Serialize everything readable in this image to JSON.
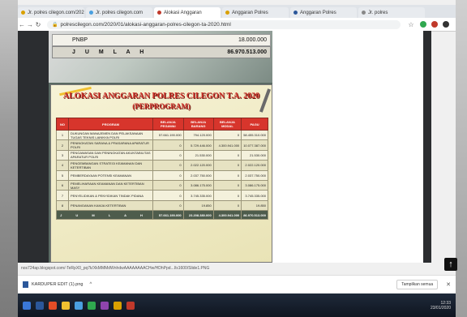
{
  "browser": {
    "tabs": [
      {
        "label": "Jr. polres cilegon.com/2020",
        "active": false,
        "color": "#d9a000"
      },
      {
        "label": "Jr. polres cilegon.com",
        "active": false,
        "color": "#4aa0e0"
      },
      {
        "label": "Alokasi Anggaran",
        "active": true,
        "color": "#c0392b"
      },
      {
        "label": "Anggaran Polres",
        "active": false,
        "color": "#d9a000"
      },
      {
        "label": "Anggaran Polres",
        "active": false,
        "color": "#2b579a"
      },
      {
        "label": "Jr. polres",
        "active": false,
        "color": "#888888"
      }
    ],
    "url": "polrescilegon.com/2020/01/alokasi-anggaran-polres-cilegon-ta-2020.html"
  },
  "document": {
    "top_rows": [
      {
        "label": "PNBP",
        "value": "18.000.000"
      },
      {
        "label": "J U M L A H",
        "value": "86.970.513.000"
      }
    ],
    "title": "ALOKASI ANGGARAN POLRES CILEGON T.A. 2020",
    "subtitle": "(PERPROGRAM)",
    "table": {
      "headers": [
        "NO",
        "PROGRAM",
        "BELANJA PEGAWAI",
        "BELANJA BARANG",
        "BELANJA MODAL",
        "PAGU"
      ],
      "rows": [
        [
          "1",
          "DUKUNGAN MANAJEMEN DAN PELAKSANAAN TUGAS TEKNIS LAINNYA POLRI",
          "57.661.190.000",
          "794.120.000",
          "0",
          "58.455.310.000"
        ],
        [
          "2",
          "PENINGKATAN SARANA & PRASARANA APARATUR POLRI",
          "0",
          "5.729.446.000",
          "4.300.941.000",
          "10.077.387.000"
        ],
        [
          "3",
          "PENGAWASAN DAN PENINGKATAN AKUNTABILITAS APARATUR POLRI",
          "0",
          "21.530.000",
          "0",
          "21.530.000"
        ],
        [
          "4",
          "PENGEMBANGAN STRATEGI KEAMANAN DAN KETERTIBAN",
          "0",
          "2.022.120.000",
          "0",
          "2.022.120.000"
        ],
        [
          "5",
          "PEMBERDAYAAN POTENSI KEAMANAN",
          "0",
          "2.037.750.000",
          "0",
          "2.037.750.000"
        ],
        [
          "6",
          "PEMELIHARAAN KEAMANAN DAN KETERTIBAN MASY",
          "0",
          "3.086.175.000",
          "0",
          "3.086.175.000"
        ],
        [
          "7",
          "PENYELIDIKAN & PENYIDIKAN TINDAK PIDANA",
          "0",
          "3.745.335.000",
          "0",
          "3.745.335.000"
        ],
        [
          "8",
          "PENANGANAN KAMJA KETERTIBAN",
          "0",
          "19.850",
          "0",
          "19.850"
        ]
      ],
      "total": [
        "J U M L A H",
        "57.661.190.000",
        "23.208.380.000",
        "4.300.941.000",
        "86.970.513.000"
      ]
    }
  },
  "status_url": "nos724ap.blogspot.com/-TeRpX0_pq7k/XkMMMdWnhdwAAAAAAAACHw/HDhPpd...l/s1600/Slide1.PNG",
  "download": {
    "file_name": "KARDUPER EDIT (1).png",
    "show_all": "Tampilkan semua",
    "close": "✕",
    "caret": "^"
  },
  "scroll_top": "↑",
  "taskbar": {
    "icons": [
      "#2b579a",
      "#e44d26",
      "#f0c030",
      "#4aa0e0",
      "#2fa84f",
      "#8e44ad",
      "#d9a000",
      "#c0392b"
    ],
    "clock_time": "12:33",
    "clock_date": "23/01/2020"
  }
}
